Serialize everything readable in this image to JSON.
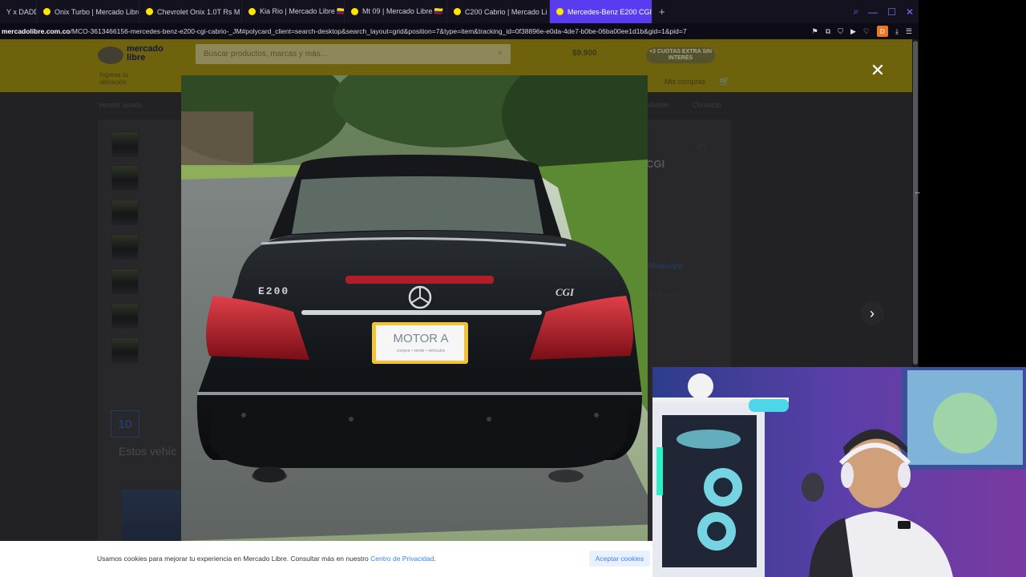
{
  "browser": {
    "tabs": [
      {
        "label": "Y x DADDY",
        "active": false
      },
      {
        "label": "Onix Turbo | Mercado Libre",
        "active": false
      },
      {
        "label": "Chevrolet Onix 1.0T Rs M",
        "active": false
      },
      {
        "label": "Kia Rio | Mercado Libre 🇨🇴",
        "active": false
      },
      {
        "label": "Mt 09 | Mercado Libre 🇨🇴",
        "active": false
      },
      {
        "label": "C200 Cabrio | Mercado Li",
        "active": false
      },
      {
        "label": "Mercedes-Benz E200 CGI",
        "active": true
      }
    ],
    "new_tab_label": "+",
    "url_domain": "mercadolibre.com.co",
    "url_path": "/MCO-3613466156-mercedes-benz-e200-cgi-cabrio-_JM#polycard_client=search-desktop&search_layout=grid&position=7&type=item&tracking_id=0f38896e-e0da-4de7-b0be-06ba00ee1d1b&gid=1&pid=7",
    "profile_initial": "D"
  },
  "page": {
    "logo_line1": "mercado",
    "logo_line2": "libre",
    "search_placeholder": "Buscar productos, marcas y más...",
    "location_line1": "Ingresa tu",
    "location_line2": "ubicación",
    "promo_price": "$9.900",
    "promo_badge": "+3 CUOTAS EXTRA SIN INTERÉS",
    "my_purchases": "Mis compras",
    "nav_left": "Vender usado",
    "nav_right_1": "Vender",
    "nav_right_2": "Contacto",
    "title_fragment": "CGI",
    "whatsapp_label": "WhatsApp",
    "avisos_label": "Ver 5 avisos",
    "thumb_more": "10",
    "similar_title": "Estos vehíc"
  },
  "lightbox": {
    "close_label": "✕",
    "next_label": "›",
    "plate_text": "MOTOR A",
    "plate_sub": "compra • vende • vehículos",
    "badge_left": "E200",
    "badge_right": "CGI"
  },
  "cookie": {
    "text": "Usamos cookies para mejorar tu experiencia en Mercado Libre. Consultar más en nuestro ",
    "link": "Centro de Privacidad",
    "accept": "Aceptar cookies"
  },
  "colors": {
    "tab_active": "#5a3cf0",
    "ml_yellow": "#ffe600",
    "ml_blue": "#3483fa"
  }
}
